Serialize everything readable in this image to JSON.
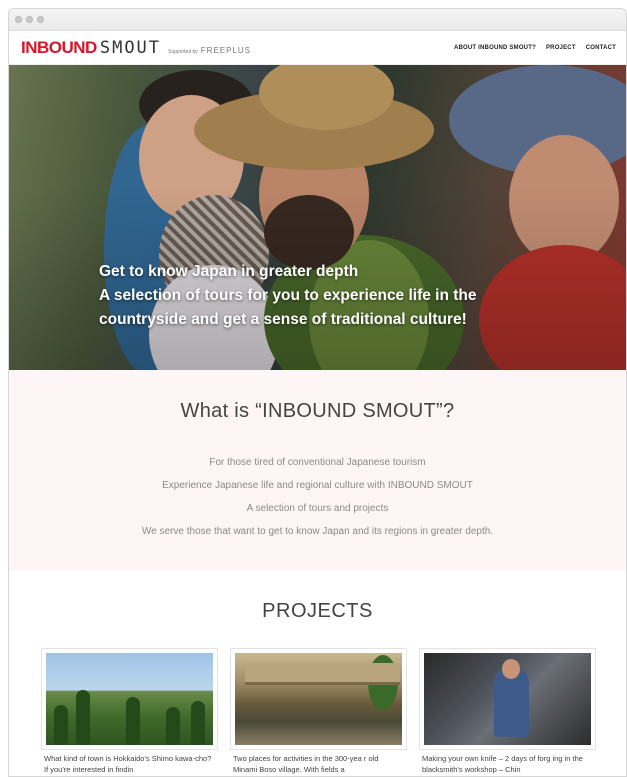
{
  "site": {
    "logo_brand": "INBOUND",
    "logo_name": "SMOUT",
    "logo_supported": "Supported by",
    "logo_partner": "FREEPLUS"
  },
  "nav": {
    "about": "ABOUT INBOUND SMOUT?",
    "project": "PROJECT",
    "contact": "CONTACT"
  },
  "hero": {
    "line1": "Get to know Japan in greater depth",
    "line2": "A selection of tours for you to experience life in the",
    "line3": "countryside and get a sense of traditional culture!"
  },
  "about": {
    "title": "What is “INBOUND SMOUT”?",
    "lines": [
      "For those tired of conventional Japanese tourism",
      "Experience Japanese life and regional culture with INBOUND SMOUT",
      "A selection of tours and projects",
      "We serve those that want to get to know Japan and its regions in greater depth."
    ]
  },
  "projects": {
    "title": "PROJECTS",
    "cards": [
      {
        "text": "What kind of town is Hokkaido's Shimo kawa-cho? If you're interested in findin"
      },
      {
        "text": "Two places for activities in the 300-yea r old Minami Boso village. With fields a"
      },
      {
        "text": "Making your own knife – 2 days of forg ing in the blacksmith's workshop – Chin"
      }
    ]
  },
  "colors": {
    "brand_red": "#d5162c",
    "about_bg": "#fdf5f6"
  }
}
